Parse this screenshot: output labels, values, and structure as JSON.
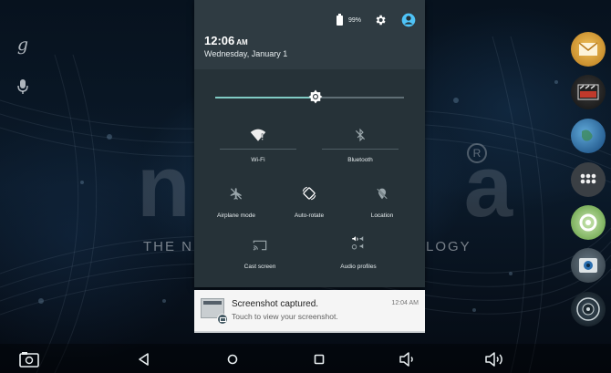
{
  "wallpaper": {
    "brand_tagline_left": "THE N",
    "brand_tagline_right": "LOGY",
    "reg_mark": "R"
  },
  "left_icons": [
    {
      "name": "google-search-icon",
      "glyph": "g"
    },
    {
      "name": "microphone-icon",
      "glyph": "🎙"
    }
  ],
  "status": {
    "battery": "99%",
    "time": "12:06",
    "ampm": "AM",
    "date": "Wednesday, January 1"
  },
  "brightness": {
    "level": 0.53
  },
  "tiles": [
    {
      "id": "wifi",
      "label": "Wi-Fi",
      "icon": "wifi-icon"
    },
    {
      "id": "bluetooth",
      "label": "Bluetooth",
      "icon": "bluetooth-off-icon"
    },
    {
      "id": "airplane",
      "label": "Airplane mode",
      "icon": "airplane-icon"
    },
    {
      "id": "autorotate",
      "label": "Auto-rotate",
      "icon": "auto-rotate-icon"
    },
    {
      "id": "location",
      "label": "Location",
      "icon": "location-off-icon"
    },
    {
      "id": "cast",
      "label": "Cast screen",
      "icon": "cast-icon"
    },
    {
      "id": "audio",
      "label": "Audio profiles",
      "icon": "audio-profiles-icon"
    }
  ],
  "notification": {
    "title": "Screenshot captured.",
    "text": "Touch to view your screenshot.",
    "time": "12:04 AM"
  },
  "colors": {
    "shade": "#263238",
    "accent": "#80cbc4",
    "user_icon": "#4fc3f7"
  }
}
